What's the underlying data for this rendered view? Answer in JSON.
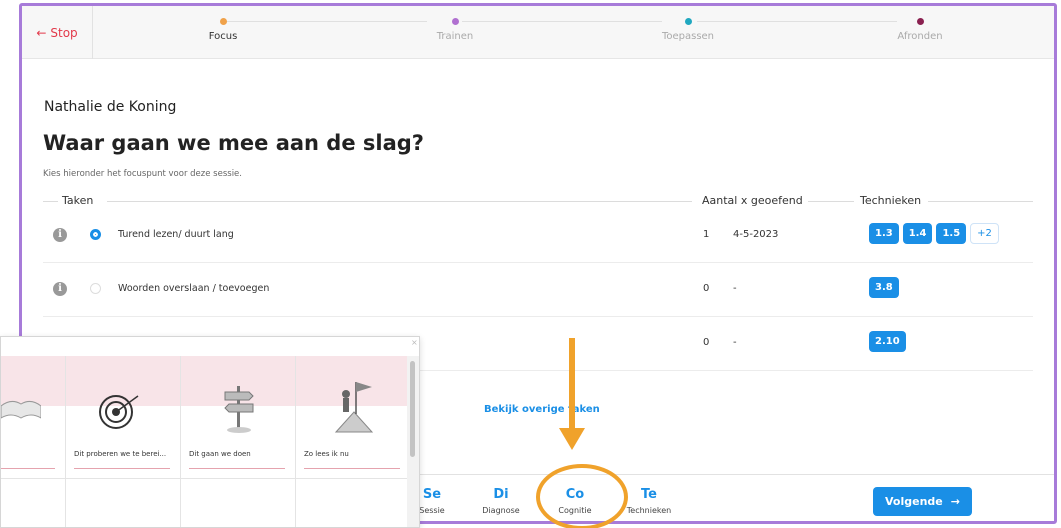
{
  "topbar": {
    "stop_label": "Stop",
    "steps": [
      {
        "label": "Focus",
        "color": "#f0a24a",
        "active": true
      },
      {
        "label": "Trainen",
        "color": "#b070d0"
      },
      {
        "label": "Toepassen",
        "color": "#20a8c0"
      },
      {
        "label": "Afronden",
        "color": "#8a2050"
      }
    ]
  },
  "main": {
    "person": "Nathalie de Koning",
    "title": "Waar gaan we mee aan de slag?",
    "subtitle": "Kies hieronder het focuspunt voor deze sessie.",
    "headers": {
      "taken": "Taken",
      "aantal": "Aantal x geoefend",
      "technieken": "Technieken"
    },
    "rows": [
      {
        "task": "Turend lezen/ duurt lang",
        "selected": true,
        "count": "1",
        "date": "4-5-2023",
        "badges": [
          "1.3",
          "1.4",
          "1.5"
        ],
        "more": "+2"
      },
      {
        "task": "Woorden overslaan / toevoegen",
        "selected": false,
        "count": "0",
        "date": "-",
        "badges": [
          "3.8"
        ]
      },
      {
        "task": "",
        "selected": false,
        "count": "0",
        "date": "-",
        "badges": [
          "2.10"
        ]
      }
    ],
    "overige": "Bekijk overige taken"
  },
  "bottombar": {
    "tabs": [
      {
        "abbr": "Se",
        "label": "Sessie"
      },
      {
        "abbr": "Di",
        "label": "Diagnose"
      },
      {
        "abbr": "Co",
        "label": "Cognitie"
      },
      {
        "abbr": "Te",
        "label": "Technieken"
      }
    ],
    "next_label": "Volgende"
  },
  "popup": {
    "close": "×",
    "cards": [
      {
        "caption": "",
        "icon": "book-icon"
      },
      {
        "caption": "Dit proberen we te berei...",
        "icon": "target-icon"
      },
      {
        "caption": "Dit gaan we doen",
        "icon": "signpost-icon"
      },
      {
        "caption": "Zo lees ik nu",
        "icon": "flag-person-icon"
      }
    ]
  },
  "colors": {
    "accent": "#1a8fe6",
    "frame": "#a77bd9",
    "highlight": "#f0a22b",
    "stop": "#e2394a"
  }
}
